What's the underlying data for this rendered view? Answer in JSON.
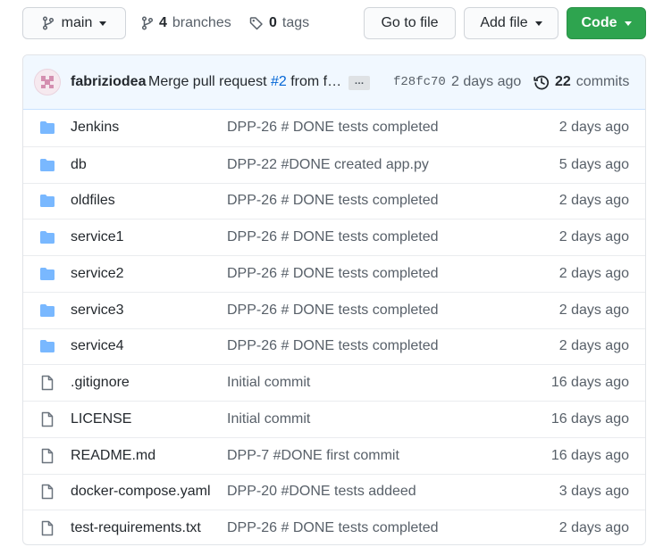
{
  "toolbar": {
    "branch_label": "main",
    "branches_count": "4",
    "branches_label": "branches",
    "tags_count": "0",
    "tags_label": "tags",
    "go_to_file_label": "Go to file",
    "add_file_label": "Add file",
    "code_label": "Code"
  },
  "commit": {
    "author": "fabriziodea",
    "message_prefix": "Merge pull request ",
    "pr_number": "#2",
    "message_suffix": " from f…",
    "ellipsis_label": "…",
    "sha": "f28fc70",
    "time": "2 days ago",
    "commits_count": "22",
    "commits_label": "commits"
  },
  "files": [
    {
      "type": "folder",
      "name": "Jenkins",
      "message": "DPP-26 # DONE tests completed",
      "age": "2 days ago"
    },
    {
      "type": "folder",
      "name": "db",
      "message": "DPP-22 #DONE created app.py",
      "age": "5 days ago"
    },
    {
      "type": "folder",
      "name": "oldfiles",
      "message": "DPP-26 # DONE tests completed",
      "age": "2 days ago"
    },
    {
      "type": "folder",
      "name": "service1",
      "message": "DPP-26 # DONE tests completed",
      "age": "2 days ago"
    },
    {
      "type": "folder",
      "name": "service2",
      "message": "DPP-26 # DONE tests completed",
      "age": "2 days ago"
    },
    {
      "type": "folder",
      "name": "service3",
      "message": "DPP-26 # DONE tests completed",
      "age": "2 days ago"
    },
    {
      "type": "folder",
      "name": "service4",
      "message": "DPP-26 # DONE tests completed",
      "age": "2 days ago"
    },
    {
      "type": "file",
      "name": ".gitignore",
      "message": "Initial commit",
      "age": "16 days ago"
    },
    {
      "type": "file",
      "name": "LICENSE",
      "message": "Initial commit",
      "age": "16 days ago"
    },
    {
      "type": "file",
      "name": "README.md",
      "message": "DPP-7 #DONE first commit",
      "age": "16 days ago"
    },
    {
      "type": "file",
      "name": "docker-compose.yaml",
      "message": "DPP-20 #DONE tests addeed",
      "age": "3 days ago"
    },
    {
      "type": "file",
      "name": "test-requirements.txt",
      "message": "DPP-26 # DONE tests completed",
      "age": "2 days ago"
    }
  ],
  "colors": {
    "folder_icon": "#79b8ff",
    "file_icon": "#6a737d",
    "code_button": "#2ea44f",
    "link": "#0366d6"
  }
}
